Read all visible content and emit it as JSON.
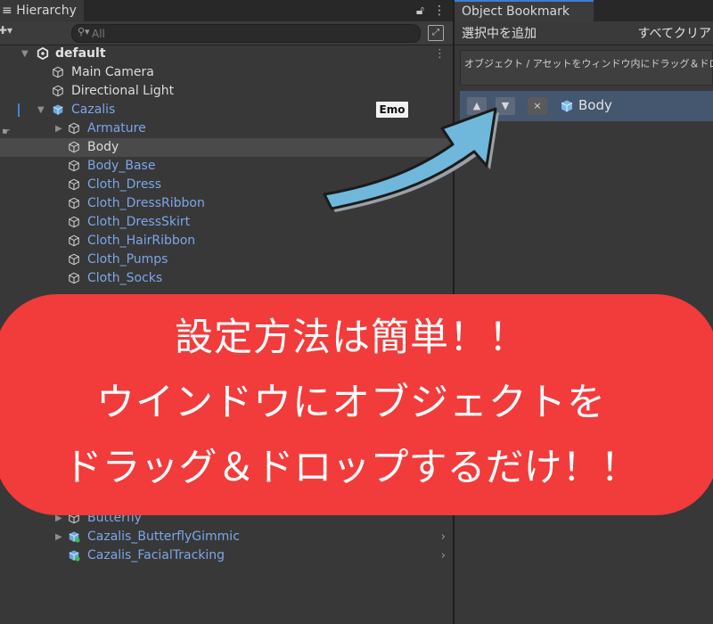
{
  "hierarchy": {
    "tab_title": "Hierarchy",
    "lock_icon": "lock-icon",
    "menu_icon": "kebab-menu-icon",
    "search_placeholder": "All",
    "scene_name": "default",
    "items": [
      {
        "label": "Main Camera",
        "style": "white"
      },
      {
        "label": "Directional Light",
        "style": "white"
      },
      {
        "label": "Cazalis",
        "style": "blue"
      },
      {
        "label": "Armature",
        "style": "blue"
      },
      {
        "label": "Body",
        "style": "white"
      },
      {
        "label": "Body_Base",
        "style": "blue"
      },
      {
        "label": "Cloth_Dress",
        "style": "blue"
      },
      {
        "label": "Cloth_DressRibbon",
        "style": "blue"
      },
      {
        "label": "Cloth_DressSkirt",
        "style": "blue"
      },
      {
        "label": "Cloth_HairRibbon",
        "style": "blue"
      },
      {
        "label": "Cloth_Pumps",
        "style": "blue"
      },
      {
        "label": "Cloth_Socks",
        "style": "blue"
      },
      {
        "label": "Butterfly",
        "style": "blue"
      },
      {
        "label": "Cazalis_ButterflyGimmic",
        "style": "blue"
      },
      {
        "label": "Cazalis_FacialTracking",
        "style": "blue"
      }
    ],
    "emo_tag": "Emo"
  },
  "bookmark": {
    "tab_title": "Object Bookmark",
    "add_selected": "選択中を追加",
    "clear_all": "すべてクリア",
    "drop_hint": "オブジェクト / アセットをウィンドウ内にドラッグ＆ドロップ",
    "item_label": "Body",
    "remove_symbol": "×"
  },
  "banner": {
    "line1": "設定方法は簡単！！",
    "line2": "ウインドウにオブジェクトを",
    "line3": "ドラッグ＆ドロップするだけ！！"
  },
  "colors": {
    "banner": "#f23b3b",
    "arrow": "#6fb8dc",
    "selection_accent": "#3c86d8",
    "blue_label": "#7ca6e8"
  }
}
